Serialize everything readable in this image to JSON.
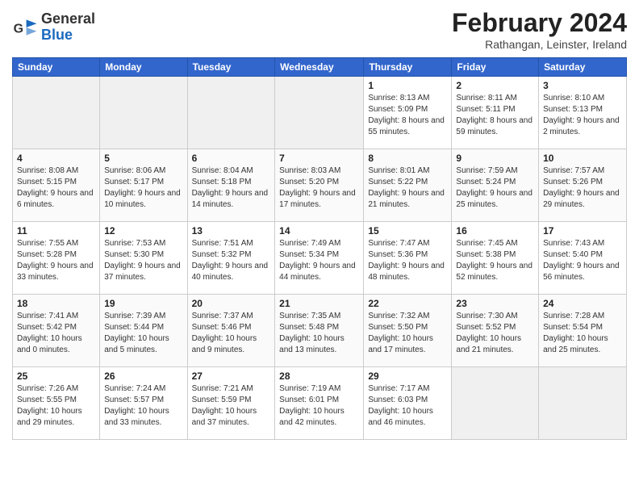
{
  "header": {
    "logo_general": "General",
    "logo_blue": "Blue",
    "month": "February 2024",
    "location": "Rathangan, Leinster, Ireland"
  },
  "days_of_week": [
    "Sunday",
    "Monday",
    "Tuesday",
    "Wednesday",
    "Thursday",
    "Friday",
    "Saturday"
  ],
  "weeks": [
    [
      {
        "num": "",
        "info": ""
      },
      {
        "num": "",
        "info": ""
      },
      {
        "num": "",
        "info": ""
      },
      {
        "num": "",
        "info": ""
      },
      {
        "num": "1",
        "sunrise": "8:13 AM",
        "sunset": "5:09 PM",
        "daylight": "8 hours and 55 minutes."
      },
      {
        "num": "2",
        "sunrise": "8:11 AM",
        "sunset": "5:11 PM",
        "daylight": "8 hours and 59 minutes."
      },
      {
        "num": "3",
        "sunrise": "8:10 AM",
        "sunset": "5:13 PM",
        "daylight": "9 hours and 2 minutes."
      }
    ],
    [
      {
        "num": "4",
        "sunrise": "8:08 AM",
        "sunset": "5:15 PM",
        "daylight": "9 hours and 6 minutes."
      },
      {
        "num": "5",
        "sunrise": "8:06 AM",
        "sunset": "5:17 PM",
        "daylight": "9 hours and 10 minutes."
      },
      {
        "num": "6",
        "sunrise": "8:04 AM",
        "sunset": "5:18 PM",
        "daylight": "9 hours and 14 minutes."
      },
      {
        "num": "7",
        "sunrise": "8:03 AM",
        "sunset": "5:20 PM",
        "daylight": "9 hours and 17 minutes."
      },
      {
        "num": "8",
        "sunrise": "8:01 AM",
        "sunset": "5:22 PM",
        "daylight": "9 hours and 21 minutes."
      },
      {
        "num": "9",
        "sunrise": "7:59 AM",
        "sunset": "5:24 PM",
        "daylight": "9 hours and 25 minutes."
      },
      {
        "num": "10",
        "sunrise": "7:57 AM",
        "sunset": "5:26 PM",
        "daylight": "9 hours and 29 minutes."
      }
    ],
    [
      {
        "num": "11",
        "sunrise": "7:55 AM",
        "sunset": "5:28 PM",
        "daylight": "9 hours and 33 minutes."
      },
      {
        "num": "12",
        "sunrise": "7:53 AM",
        "sunset": "5:30 PM",
        "daylight": "9 hours and 37 minutes."
      },
      {
        "num": "13",
        "sunrise": "7:51 AM",
        "sunset": "5:32 PM",
        "daylight": "9 hours and 40 minutes."
      },
      {
        "num": "14",
        "sunrise": "7:49 AM",
        "sunset": "5:34 PM",
        "daylight": "9 hours and 44 minutes."
      },
      {
        "num": "15",
        "sunrise": "7:47 AM",
        "sunset": "5:36 PM",
        "daylight": "9 hours and 48 minutes."
      },
      {
        "num": "16",
        "sunrise": "7:45 AM",
        "sunset": "5:38 PM",
        "daylight": "9 hours and 52 minutes."
      },
      {
        "num": "17",
        "sunrise": "7:43 AM",
        "sunset": "5:40 PM",
        "daylight": "9 hours and 56 minutes."
      }
    ],
    [
      {
        "num": "18",
        "sunrise": "7:41 AM",
        "sunset": "5:42 PM",
        "daylight": "10 hours and 0 minutes."
      },
      {
        "num": "19",
        "sunrise": "7:39 AM",
        "sunset": "5:44 PM",
        "daylight": "10 hours and 5 minutes."
      },
      {
        "num": "20",
        "sunrise": "7:37 AM",
        "sunset": "5:46 PM",
        "daylight": "10 hours and 9 minutes."
      },
      {
        "num": "21",
        "sunrise": "7:35 AM",
        "sunset": "5:48 PM",
        "daylight": "10 hours and 13 minutes."
      },
      {
        "num": "22",
        "sunrise": "7:32 AM",
        "sunset": "5:50 PM",
        "daylight": "10 hours and 17 minutes."
      },
      {
        "num": "23",
        "sunrise": "7:30 AM",
        "sunset": "5:52 PM",
        "daylight": "10 hours and 21 minutes."
      },
      {
        "num": "24",
        "sunrise": "7:28 AM",
        "sunset": "5:54 PM",
        "daylight": "10 hours and 25 minutes."
      }
    ],
    [
      {
        "num": "25",
        "sunrise": "7:26 AM",
        "sunset": "5:55 PM",
        "daylight": "10 hours and 29 minutes."
      },
      {
        "num": "26",
        "sunrise": "7:24 AM",
        "sunset": "5:57 PM",
        "daylight": "10 hours and 33 minutes."
      },
      {
        "num": "27",
        "sunrise": "7:21 AM",
        "sunset": "5:59 PM",
        "daylight": "10 hours and 37 minutes."
      },
      {
        "num": "28",
        "sunrise": "7:19 AM",
        "sunset": "6:01 PM",
        "daylight": "10 hours and 42 minutes."
      },
      {
        "num": "29",
        "sunrise": "7:17 AM",
        "sunset": "6:03 PM",
        "daylight": "10 hours and 46 minutes."
      },
      {
        "num": "",
        "info": ""
      },
      {
        "num": "",
        "info": ""
      }
    ]
  ]
}
